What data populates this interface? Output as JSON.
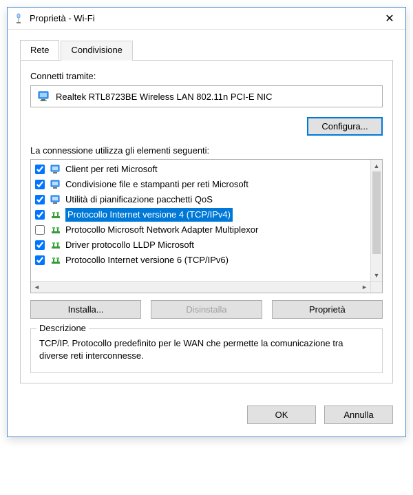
{
  "window": {
    "title": "Proprietà - Wi-Fi"
  },
  "tabs": {
    "rete": "Rete",
    "condivisione": "Condivisione"
  },
  "connect_via_label": "Connetti tramite:",
  "adapter_name": "Realtek RTL8723BE Wireless LAN 802.11n PCI-E NIC",
  "buttons": {
    "configure": "Configura...",
    "install": "Installa...",
    "uninstall": "Disinstalla",
    "properties": "Proprietà",
    "ok": "OK",
    "cancel": "Annulla"
  },
  "elements_label": "La connessione utilizza gli elementi seguenti:",
  "items": [
    {
      "checked": true,
      "icon": "client",
      "label": "Client per reti Microsoft",
      "selected": false
    },
    {
      "checked": true,
      "icon": "share",
      "label": "Condivisione file e stampanti per reti Microsoft",
      "selected": false
    },
    {
      "checked": true,
      "icon": "qos",
      "label": "Utilità di pianificazione pacchetti QoS",
      "selected": false
    },
    {
      "checked": true,
      "icon": "proto",
      "label": "Protocollo Internet versione 4 (TCP/IPv4)",
      "selected": true
    },
    {
      "checked": false,
      "icon": "proto",
      "label": "Protocollo Microsoft Network Adapter Multiplexor",
      "selected": false
    },
    {
      "checked": true,
      "icon": "proto",
      "label": "Driver protocollo LLDP Microsoft",
      "selected": false
    },
    {
      "checked": true,
      "icon": "proto",
      "label": "Protocollo Internet versione 6 (TCP/IPv6)",
      "selected": false
    }
  ],
  "description": {
    "legend": "Descrizione",
    "text": "TCP/IP. Protocollo predefinito per le WAN che permette la comunicazione tra diverse reti interconnesse."
  }
}
